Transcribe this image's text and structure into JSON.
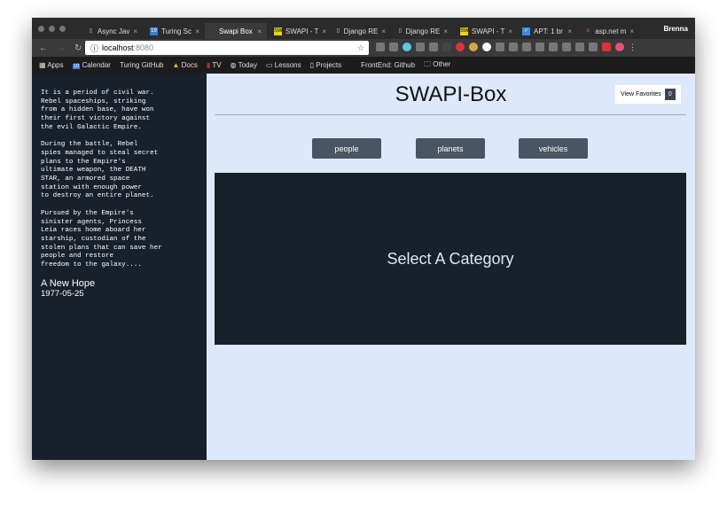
{
  "browser": {
    "tabs": [
      {
        "title": "Async Jav",
        "icon": "document-icon"
      },
      {
        "title": "Turing Sc",
        "icon": "calendar-icon"
      },
      {
        "title": "Swapi Box",
        "icon": "none",
        "active": true
      },
      {
        "title": "SWAPI - T",
        "icon": "swapi-icon"
      },
      {
        "title": "Django RE",
        "icon": "document-icon"
      },
      {
        "title": "Django RE",
        "icon": "document-icon"
      },
      {
        "title": "SWAPI - T",
        "icon": "swapi-icon"
      },
      {
        "title": "APT: 1 br",
        "icon": "apt-icon"
      },
      {
        "title": "asp.net m",
        "icon": "stack-icon"
      }
    ],
    "user": "Brenna",
    "url_host": "localhost",
    "url_port": ":8080",
    "bookmarks": [
      "Apps",
      "Calendar",
      "Turing GitHub",
      "Docs",
      "TV",
      "Today",
      "Lessons",
      "Projects",
      "FrontEnd: Github",
      "Other"
    ]
  },
  "sidebar": {
    "crawl": "It is a period of civil war.\nRebel spaceships, striking\nfrom a hidden base, have won\ntheir first victory against\nthe evil Galactic Empire.\n\nDuring the battle, Rebel\nspies managed to steal secret\nplans to the Empire's\nultimate weapon, the DEATH\nSTAR, an armored space\nstation with enough power\nto destroy an entire planet.\n\nPursued by the Empire's\nsinister agents, Princess\nLeia races home aboard her\nstarship, custodian of the\nstolen plans that can save her\npeople and restore\nfreedom to the galaxy....",
    "title": "A New Hope",
    "release_date": "1977-05-25"
  },
  "main": {
    "title": "SWAPI-Box",
    "favorites_label": "View Favorites",
    "favorites_count": "0",
    "categories": [
      "people",
      "planets",
      "vehicles"
    ],
    "placeholder": "Select A Category"
  },
  "colors": {
    "sidebar": "#18202b",
    "main_bg": "#dde9fb",
    "button": "#4a5563"
  }
}
